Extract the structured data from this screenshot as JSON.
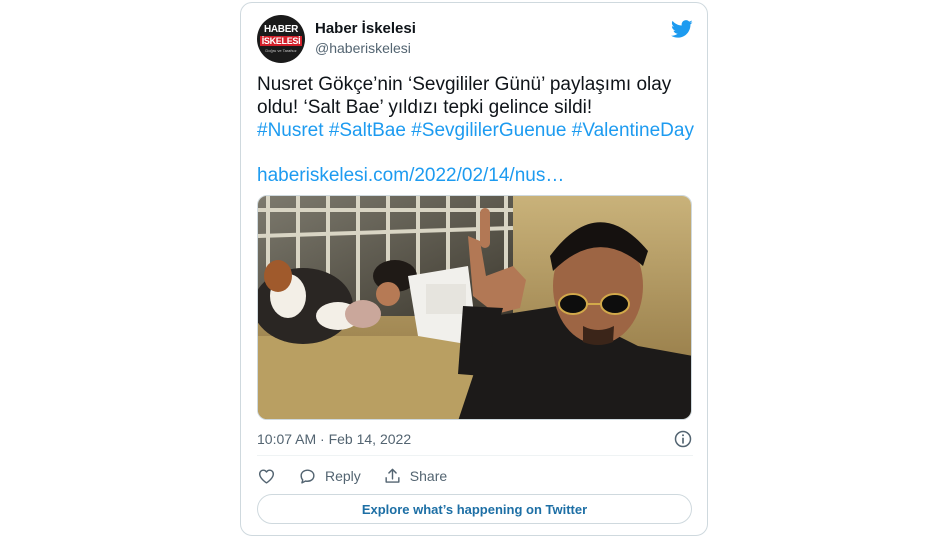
{
  "account": {
    "display_name": "Haber İskelesi",
    "handle": "@haberiskelesi",
    "avatar_line1": "HABER",
    "avatar_line2": "İSKELESİ",
    "avatar_line3": "Doğru ve Tarafsız"
  },
  "tweet": {
    "line1": "Nusret Gökçe’nin ‘Sevgililer Günü’ paylaşımı olay",
    "line2": "oldu! ‘Salt Bae’ yıldızı tepki gelince sildi!",
    "hashtags": [
      "#Nusret",
      "#SaltBae",
      "#SevgililerGuenue",
      "#ValentineDay"
    ],
    "link": "haberiskelesi.com/2022/02/14/nus…",
    "timestamp": "10:07 AM · Feb 14, 2022"
  },
  "actions": {
    "reply_label": "Reply",
    "share_label": "Share"
  },
  "explore_label": "Explore what’s happening on Twitter",
  "colors": {
    "accent": "#1d9bf0",
    "text": "#0f1419",
    "muted": "#536471",
    "border": "#cfd9de"
  }
}
